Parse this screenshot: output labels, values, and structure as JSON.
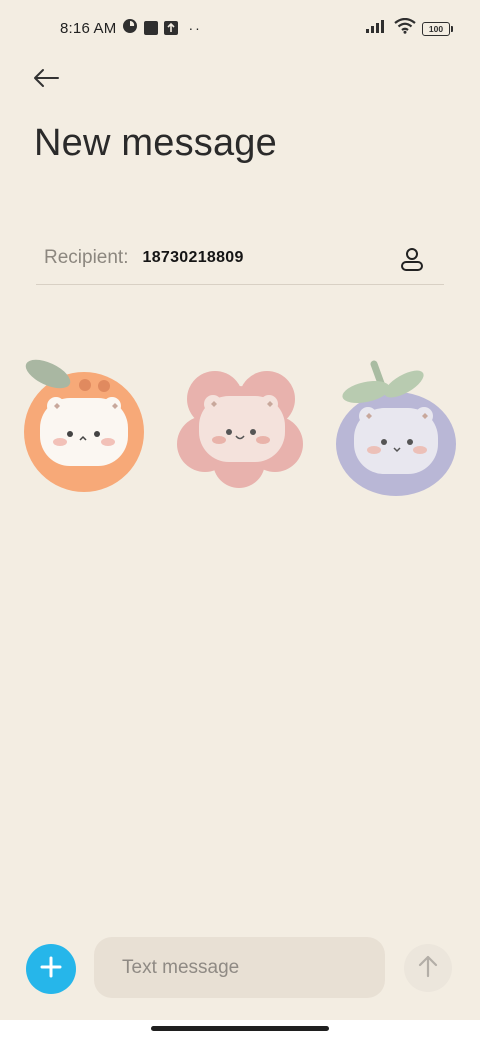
{
  "status_bar": {
    "time": "8:16 AM",
    "battery": "100",
    "dots": "··"
  },
  "header": {
    "title": "New message"
  },
  "recipient": {
    "label": "Recipient:",
    "value": "18730218809"
  },
  "stickers": [
    {
      "name": "orange-bear-sticker",
      "color": "#f7a978"
    },
    {
      "name": "pink-flower-bear-sticker",
      "color": "#e8b2ad"
    },
    {
      "name": "blueberry-bear-sticker",
      "color": "#b9b7d6"
    }
  ],
  "composer": {
    "placeholder": "Text message"
  },
  "colors": {
    "background": "#f3ede2",
    "accent": "#26b6ea",
    "input_bg": "#e8e0d4"
  }
}
